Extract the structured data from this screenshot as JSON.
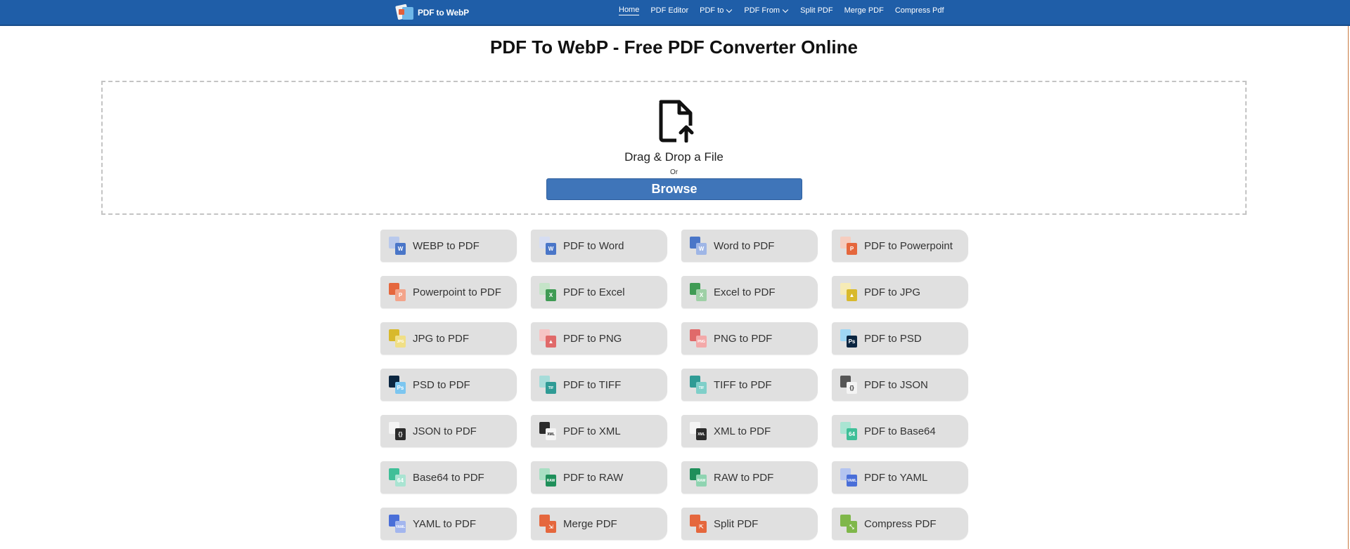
{
  "header": {
    "logo_text": "PDF to WebP",
    "nav": [
      {
        "label": "Home",
        "active": true,
        "dropdown": false
      },
      {
        "label": "PDF Editor",
        "active": false,
        "dropdown": false
      },
      {
        "label": "PDF to",
        "active": false,
        "dropdown": true
      },
      {
        "label": "PDF From",
        "active": false,
        "dropdown": true
      },
      {
        "label": "Split PDF",
        "active": false,
        "dropdown": false
      },
      {
        "label": "Merge PDF",
        "active": false,
        "dropdown": false
      },
      {
        "label": "Compress Pdf",
        "active": false,
        "dropdown": false
      }
    ]
  },
  "page": {
    "title": "PDF To WebP - Free PDF Converter Online"
  },
  "upload": {
    "icon": "file-upload-icon",
    "drop_text": "Drag & Drop a File",
    "or_text": "Or",
    "browse_label": "Browse"
  },
  "colors": {
    "header_bg": "#1f5ea8",
    "browse_bg": "#3f75b9",
    "tile_bg": "#e0e0e0"
  },
  "tools": [
    {
      "label": "WEBP to PDF",
      "icon": "word-doc-icon",
      "back": "#b9c9ec",
      "front": "#4a76c8",
      "glyph": "W"
    },
    {
      "label": "PDF to Word",
      "icon": "word-doc-icon",
      "back": "#d6ddf2",
      "front": "#4a76c8",
      "glyph": "W"
    },
    {
      "label": "Word to PDF",
      "icon": "word-doc-icon",
      "back": "#4a76c8",
      "front": "#9fb6e6",
      "glyph": "W"
    },
    {
      "label": "PDF to Powerpoint",
      "icon": "powerpoint-icon",
      "back": "#f6cdbf",
      "front": "#e5673d",
      "glyph": "P"
    },
    {
      "label": "Powerpoint to PDF",
      "icon": "powerpoint-icon",
      "back": "#e5673d",
      "front": "#f3a48a",
      "glyph": "P"
    },
    {
      "label": "PDF to Excel",
      "icon": "excel-icon",
      "back": "#c5e4c8",
      "front": "#3f9b54",
      "glyph": "X"
    },
    {
      "label": "Excel to PDF",
      "icon": "excel-icon",
      "back": "#3f9b54",
      "front": "#9ed0a6",
      "glyph": "X"
    },
    {
      "label": "PDF to JPG",
      "icon": "jpg-image-icon",
      "back": "#f6ebb6",
      "front": "#d8b92c",
      "glyph": "▲"
    },
    {
      "label": "JPG to PDF",
      "icon": "jpg-image-icon",
      "back": "#d8b92c",
      "front": "#f0df86",
      "glyph": "JPG"
    },
    {
      "label": "PDF to PNG",
      "icon": "png-image-icon",
      "back": "#f6c4c4",
      "front": "#e06a6a",
      "glyph": "▲"
    },
    {
      "label": "PNG to PDF",
      "icon": "png-image-icon",
      "back": "#e06a6a",
      "front": "#f3a9a9",
      "glyph": "PNG"
    },
    {
      "label": "PDF to PSD",
      "icon": "photoshop-icon",
      "back": "#9fd7f4",
      "front": "#0a2540",
      "glyph": "Ps"
    },
    {
      "label": "PSD to PDF",
      "icon": "photoshop-icon",
      "back": "#0a2540",
      "front": "#7cc6f0",
      "glyph": "Ps"
    },
    {
      "label": "PDF to TIFF",
      "icon": "tiff-icon",
      "back": "#a6dcd9",
      "front": "#2f9b95",
      "glyph": "TIF"
    },
    {
      "label": "TIFF to PDF",
      "icon": "tiff-icon",
      "back": "#2f9b95",
      "front": "#7fcfc9",
      "glyph": "TIF"
    },
    {
      "label": "PDF to JSON",
      "icon": "json-icon",
      "back": "#555555",
      "front": "#f4f4f4",
      "glyph": "{}"
    },
    {
      "label": "JSON to PDF",
      "icon": "json-icon",
      "back": "#f4f4f4",
      "front": "#2b2b2b",
      "glyph": "{}"
    },
    {
      "label": "PDF to XML",
      "icon": "xml-icon",
      "back": "#2b2b2b",
      "front": "#f4f4f4",
      "glyph": "XML"
    },
    {
      "label": "XML to PDF",
      "icon": "xml-icon",
      "back": "#f4f4f4",
      "front": "#2b2b2b",
      "glyph": "XML"
    },
    {
      "label": "PDF to Base64",
      "icon": "base64-icon",
      "back": "#a9e4d2",
      "front": "#3fbf98",
      "glyph": "64"
    },
    {
      "label": "Base64 to PDF",
      "icon": "base64-icon",
      "back": "#3fbf98",
      "front": "#a9e4d2",
      "glyph": "64"
    },
    {
      "label": "PDF to RAW",
      "icon": "raw-icon",
      "back": "#a8dfc3",
      "front": "#1f8f5a",
      "glyph": "RAW"
    },
    {
      "label": "RAW to PDF",
      "icon": "raw-icon",
      "back": "#1f8f5a",
      "front": "#8fd4b1",
      "glyph": "RAW"
    },
    {
      "label": "PDF to YAML",
      "icon": "yaml-icon",
      "back": "#b4c4f0",
      "front": "#4a6fd8",
      "glyph": "YAML"
    },
    {
      "label": "YAML to PDF",
      "icon": "yaml-icon",
      "back": "#4a6fd8",
      "front": "#a3b6ee",
      "glyph": "YAML"
    },
    {
      "label": "Merge PDF",
      "icon": "merge-icon",
      "back": "#e5673d",
      "front": "#e5673d",
      "glyph": "⇲"
    },
    {
      "label": "Split PDF",
      "icon": "split-icon",
      "back": "#e5673d",
      "front": "#e5673d",
      "glyph": "⇱"
    },
    {
      "label": "Compress PDF",
      "icon": "compress-icon",
      "back": "#7fb74a",
      "front": "#7fb74a",
      "glyph": "⤡"
    }
  ]
}
